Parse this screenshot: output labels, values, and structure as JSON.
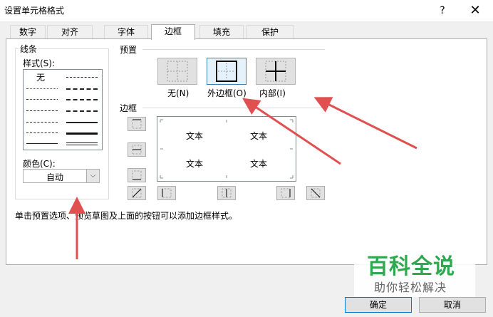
{
  "window": {
    "title": "设置单元格格式",
    "help_label": "?",
    "close_label": "✕"
  },
  "tabs": [
    {
      "label": "数字"
    },
    {
      "label": "对齐"
    },
    {
      "label": "字体"
    },
    {
      "label": "边框",
      "active": true
    },
    {
      "label": "填充"
    },
    {
      "label": "保护"
    }
  ],
  "line": {
    "group_label": "线条",
    "style_label": "样式(S):",
    "none_label": "无",
    "color_label": "颜色(C):",
    "color_value": "自动"
  },
  "presets": {
    "group_label": "预置",
    "items": [
      {
        "label": "无(N)",
        "icon": "no-border-icon"
      },
      {
        "label": "外边框(O)",
        "icon": "outline-border-icon",
        "selected": true
      },
      {
        "label": "内部(I)",
        "icon": "inside-border-icon"
      }
    ]
  },
  "border": {
    "group_label": "边框",
    "preview_texts": [
      "文本",
      "文本",
      "文本",
      "文本"
    ]
  },
  "hint": "单击预置选项、预览草图及上面的按钮可以添加边框样式。",
  "buttons": {
    "ok": "确定",
    "cancel": "取消"
  },
  "watermark": {
    "main": "百科全说",
    "sub": "助你轻松解决"
  },
  "colors": {
    "arrow": "#e05050",
    "watermark_green": "#2fa84f",
    "selected_border": "#3c7fb1"
  }
}
